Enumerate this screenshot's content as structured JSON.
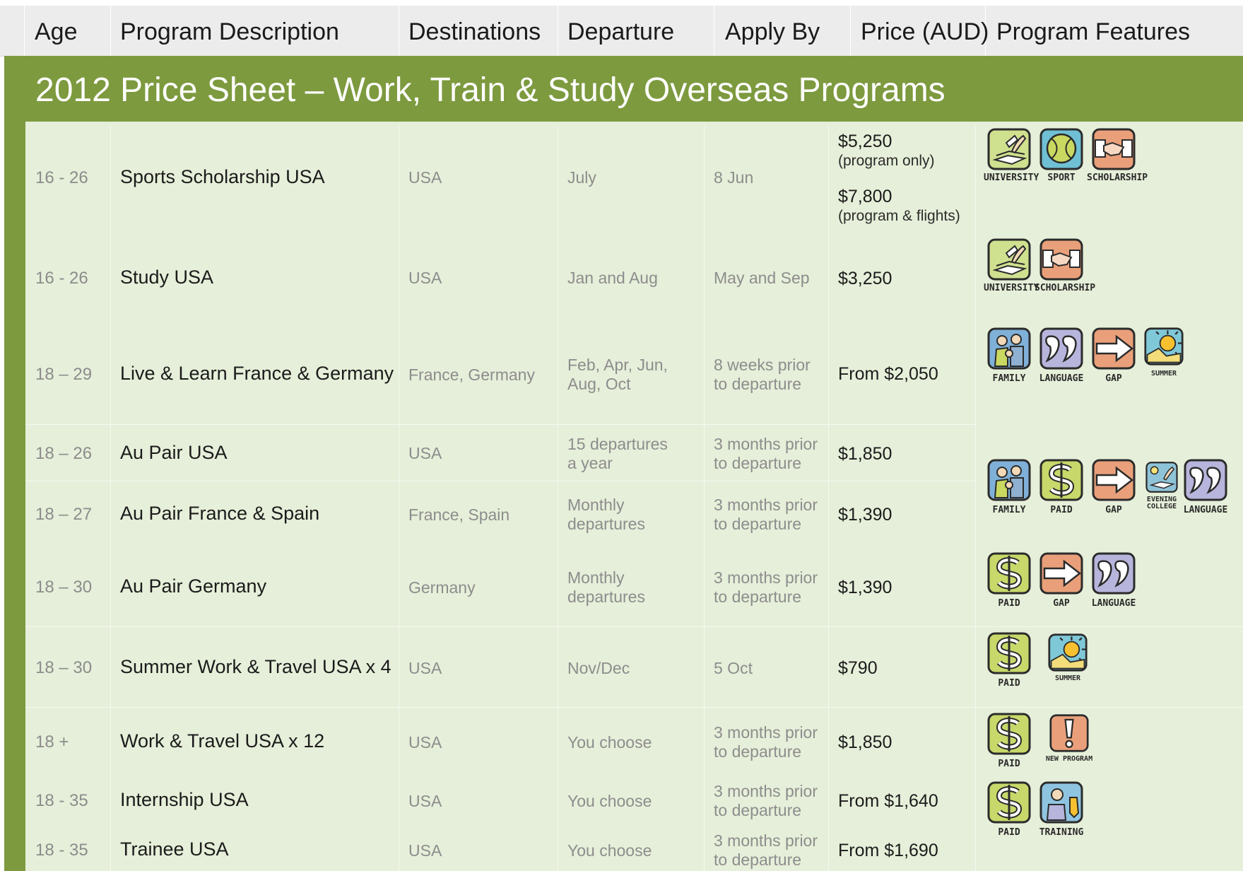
{
  "header": {
    "age": "Age",
    "program": "Program Description",
    "destinations": "Destinations",
    "departure": "Departure",
    "apply_by": "Apply By",
    "price": "Price (AUD)",
    "features": "Program Features"
  },
  "title": "2012 Price Sheet – Work, Train & Study Overseas Programs",
  "colors": {
    "accent_green": "#7d9a3f",
    "row_bg": "#e6efd9",
    "header_bg": "#ececec"
  },
  "rows": [
    {
      "age": "16 - 26",
      "program": "Sports Scholarship USA",
      "destination": "USA",
      "departure": "July",
      "apply_by": "8 Jun",
      "price_1": "$5,250",
      "price_1_note": "(program only)",
      "price_2": "$7,800",
      "price_2_note": "(program & flights)"
    },
    {
      "age": "16 - 26",
      "program": "Study USA",
      "destination": "USA",
      "departure": "Jan and Aug",
      "apply_by": "May and Sep",
      "price": "$3,250"
    },
    {
      "age": "18 – 29",
      "program": "Live & Learn France & Germany",
      "destination": "France, Germany",
      "departure_1": "Feb, Apr, Jun,",
      "departure_2": "Aug, Oct",
      "apply_by_1": "8 weeks prior",
      "apply_by_2": "to departure",
      "price": "From $2,050"
    },
    {
      "age": "18 – 26",
      "program": "Au Pair USA",
      "destination": "USA",
      "departure_1": "15 departures",
      "departure_2": "a year",
      "apply_by_1": "3 months prior",
      "apply_by_2": "to departure",
      "price": "$1,850"
    },
    {
      "age": "18 – 27",
      "program": "Au Pair France & Spain",
      "destination": "France, Spain",
      "departure_1": "Monthly",
      "departure_2": "departures",
      "apply_by_1": "3 months prior",
      "apply_by_2": "to departure",
      "price": "$1,390"
    },
    {
      "age": "18 – 30",
      "program": "Au Pair Germany",
      "destination": "Germany",
      "departure_1": "Monthly",
      "departure_2": "departures",
      "apply_by_1": "3 months prior",
      "apply_by_2": "to departure",
      "price": "$1,390"
    },
    {
      "age": "18 – 30",
      "program": "Summer Work & Travel USA x 4",
      "destination": "USA",
      "departure": "Nov/Dec",
      "apply_by": "5 Oct",
      "price": "$790"
    },
    {
      "age": "18 +",
      "program": "Work & Travel USA x 12",
      "destination": "USA",
      "departure": "You choose",
      "apply_by_1": "3 months prior",
      "apply_by_2": "to departure",
      "price": "$1,850"
    },
    {
      "age": "18 - 35",
      "program": "Internship USA",
      "destination": "USA",
      "departure": "You choose",
      "apply_by_1": "3 months prior",
      "apply_by_2": "to departure",
      "price": "From $1,640"
    },
    {
      "age": "18 - 35",
      "program": "Trainee USA",
      "destination": "USA",
      "departure": "You choose",
      "apply_by_1": "3 months prior",
      "apply_by_2": "to departure",
      "price": "From $1,690"
    }
  ],
  "feature_groups": [
    {
      "icons": [
        {
          "icon": "university-icon",
          "label": "UNIVERSITY"
        },
        {
          "icon": "sport-icon",
          "label": "SPORT"
        },
        {
          "icon": "scholarship-icon",
          "label": "SCHOLARSHIP"
        }
      ]
    },
    {
      "icons": [
        {
          "icon": "university-icon",
          "label": "UNIVERSITY"
        },
        {
          "icon": "scholarship-icon",
          "label": "SCHOLARSHIP"
        }
      ]
    },
    {
      "icons": [
        {
          "icon": "family-icon",
          "label": "FAMILY"
        },
        {
          "icon": "language-icon",
          "label": "LANGUAGE"
        },
        {
          "icon": "gap-icon",
          "label": "GAP"
        },
        {
          "icon": "summer-icon",
          "label": "SUMMER"
        }
      ]
    },
    {
      "icons": [
        {
          "icon": "family-icon",
          "label": "FAMILY"
        },
        {
          "icon": "paid-icon",
          "label": "PAID"
        },
        {
          "icon": "gap-icon",
          "label": "GAP"
        },
        {
          "icon": "evening-college-icon",
          "label_1": "EVENING",
          "label_2": "COLLEGE"
        },
        {
          "icon": "language-icon",
          "label": "LANGUAGE"
        }
      ]
    },
    {
      "icons": [
        {
          "icon": "paid-icon",
          "label": "PAID"
        },
        {
          "icon": "gap-icon",
          "label": "GAP"
        },
        {
          "icon": "language-icon",
          "label": "LANGUAGE"
        }
      ]
    },
    {
      "icons": [
        {
          "icon": "paid-icon",
          "label": "PAID"
        },
        {
          "icon": "summer-icon",
          "label": "SUMMER"
        }
      ]
    },
    {
      "icons": [
        {
          "icon": "paid-icon",
          "label": "PAID"
        },
        {
          "icon": "new-program-icon",
          "label": "NEW PROGRAM"
        }
      ]
    },
    {
      "icons": [
        {
          "icon": "paid-icon",
          "label": "PAID"
        },
        {
          "icon": "training-icon",
          "label": "TRAINING"
        }
      ]
    }
  ]
}
